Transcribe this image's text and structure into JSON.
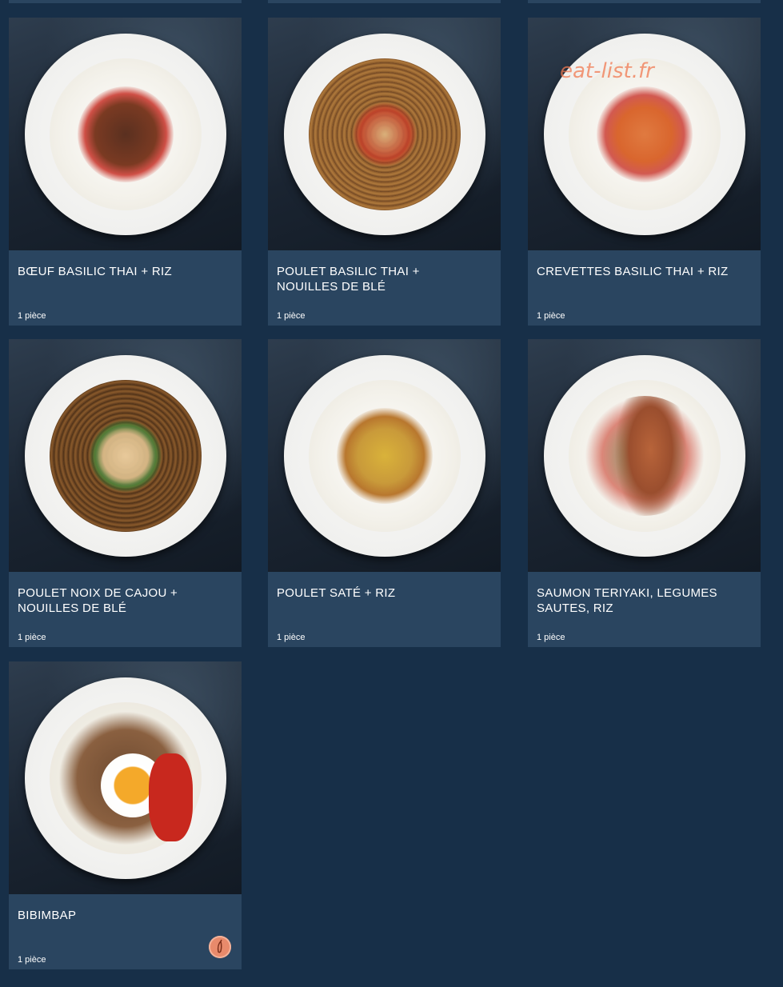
{
  "watermark": "eat-list.fr",
  "items": [
    {
      "title": "BŒUF BASILIC THAI + RIZ",
      "qty": "1 pièce",
      "spicy": false
    },
    {
      "title": "POULET BASILIC THAI + NOUILLES DE BLÉ",
      "qty": "1 pièce",
      "spicy": false
    },
    {
      "title": "CREVETTES BASILIC THAI + RIZ",
      "qty": "1 pièce",
      "spicy": false
    },
    {
      "title": "POULET NOIX DE CAJOU + NOUILLES DE BLÉ",
      "qty": "1 pièce",
      "spicy": false
    },
    {
      "title": "POULET SATÉ + RIZ",
      "qty": "1 pièce",
      "spicy": false
    },
    {
      "title": "SAUMON TERIYAKI, LEGUMES SAUTES, RIZ",
      "qty": "1 pièce",
      "spicy": false
    },
    {
      "title": "BIBIMBAP",
      "qty": "1 pièce",
      "spicy": true
    }
  ],
  "icons": {
    "spicy": "chili-pepper-icon"
  },
  "colors": {
    "background": "#172f48",
    "card": "#2a4560",
    "spicy_badge": "#e88a6b"
  }
}
